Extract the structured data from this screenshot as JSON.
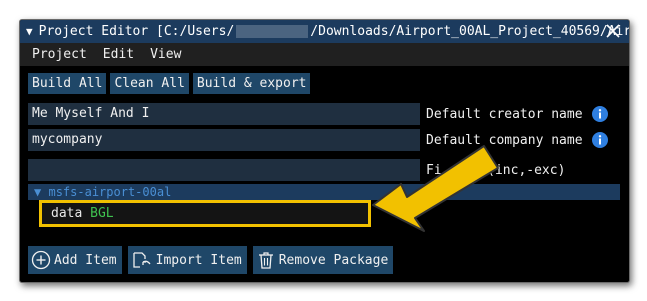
{
  "window": {
    "title_prefix": "Project Editor [C:/Users/",
    "title_suffix": "/Downloads/Airport_00AL_Project_40569/Airp",
    "close_icon": "close-icon"
  },
  "menu": [
    "Project",
    "Edit",
    "View"
  ],
  "toolbar": {
    "build_all": "Build All",
    "clean_all": "Clean All",
    "build_export": "Build & export"
  },
  "fields": {
    "creator_value": "Me Myself And I",
    "creator_label": "Default creator name",
    "company_value": "mycompany",
    "company_label": "Default company name",
    "filter_value": "",
    "filter_label_start": "Fi",
    "filter_label_end": "er (inc,-exc)"
  },
  "tree": {
    "package_name": "msfs-airport-00al",
    "item_name": "data",
    "item_type": "BGL"
  },
  "bottom_buttons": {
    "add_item": "Add Item",
    "import_item": "Import Item",
    "remove_package": "Remove Package"
  },
  "colors": {
    "titlebar": "#1c3b5e",
    "button": "#1f4768",
    "highlight": "#f2c100",
    "bgl_type": "#3fc24f",
    "info": "#2f7fe0"
  }
}
